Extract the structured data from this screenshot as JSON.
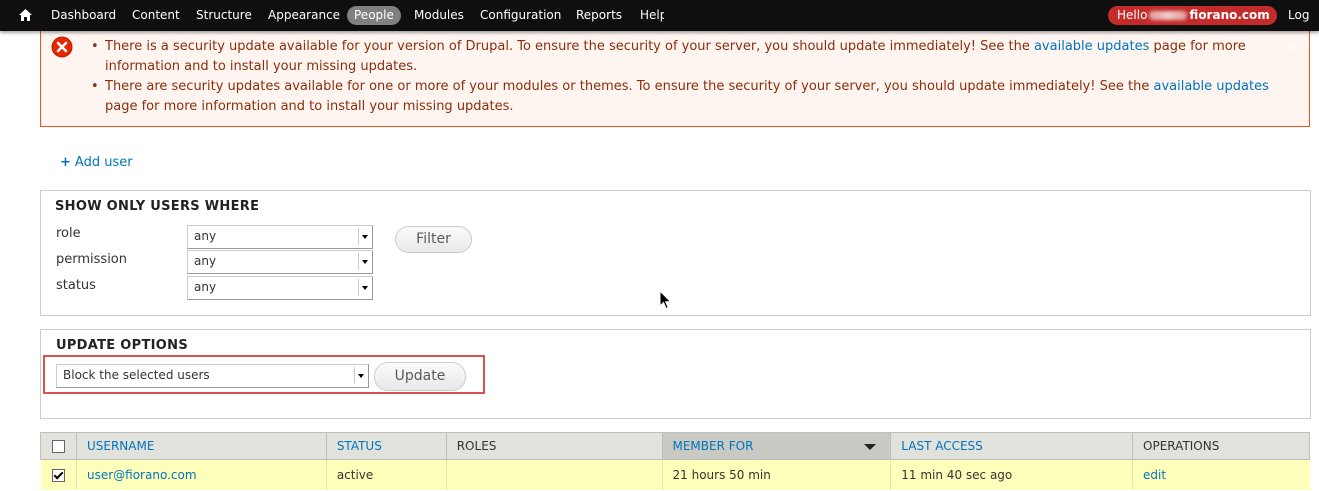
{
  "toolbar": {
    "items": [
      "Dashboard",
      "Content",
      "Structure",
      "Appearance",
      "People",
      "Modules",
      "Configuration",
      "Reports",
      "Help"
    ],
    "active": "People",
    "hello_prefix": "Hello",
    "hello_domain": "fiorano.com",
    "logout": "Log o"
  },
  "messages": {
    "items": [
      {
        "before": "There is a security update available for your version of Drupal. To ensure the security of your server, you should update immediately! See the ",
        "link": "available updates",
        "after": " page for more information and to install your missing updates."
      },
      {
        "before": "There are security updates available for one or more of your modules or themes. To ensure the security of your server, you should update immediately! See the ",
        "link": "available updates",
        "after": " page for more information and to install your missing updates."
      }
    ],
    "color_border": "#ed541d",
    "color_bg": "#fef5f1"
  },
  "add_user": {
    "icon": "plus-icon",
    "label": "Add user"
  },
  "filter": {
    "legend": "SHOW ONLY USERS WHERE",
    "fields": [
      {
        "label": "role",
        "value": "any"
      },
      {
        "label": "permission",
        "value": "any"
      },
      {
        "label": "status",
        "value": "any"
      }
    ],
    "button": "Filter"
  },
  "update_options": {
    "legend": "UPDATE OPTIONS",
    "selected": "Block the selected users",
    "button": "Update",
    "highlight_color": "#d9534f"
  },
  "table": {
    "headers": [
      "USERNAME",
      "STATUS",
      "ROLES",
      "MEMBER FOR",
      "LAST ACCESS",
      "OPERATIONS"
    ],
    "sorted_column": "MEMBER FOR",
    "rows": [
      {
        "checked": true,
        "username": "user@fiorano.com",
        "status": "active",
        "roles": "",
        "member_for": "21 hours 50 min",
        "last_access": "11 min 40 sec ago",
        "operation": "edit"
      }
    ]
  }
}
